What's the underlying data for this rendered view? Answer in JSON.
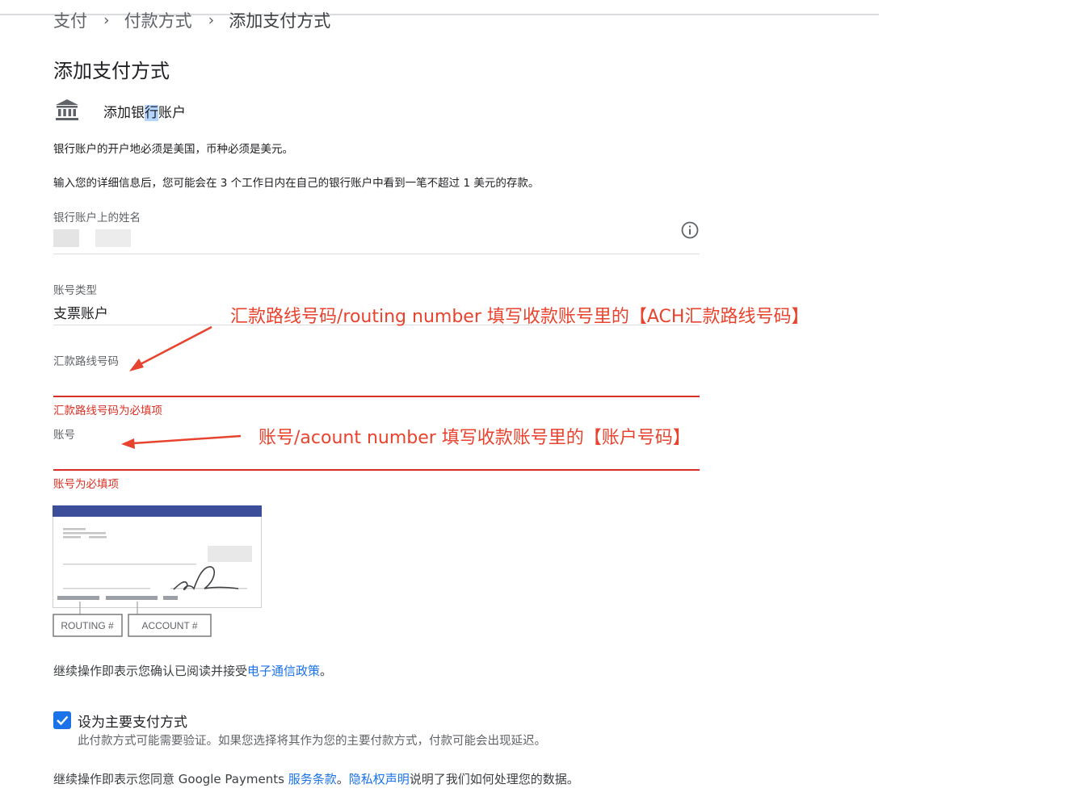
{
  "breadcrumb": {
    "items": [
      "支付",
      "付款方式",
      "添加支付方式"
    ],
    "separator": "›"
  },
  "page": {
    "title": "添加支付方式"
  },
  "bank": {
    "icon": "bank-icon",
    "label_pre": "添加银",
    "label_sel": "行",
    "label_post": "账户"
  },
  "notes": {
    "line1": "银行账户的开户地必须是美国，币种必须是美元。",
    "line2": "输入您的详细信息后，您可能会在 3 个工作日内在自己的银行账户中看到一笔不超过 1 美元的存款。"
  },
  "fields": {
    "name": {
      "label": "银行账户上的姓名",
      "info_icon": "info-icon"
    },
    "account_type": {
      "label": "账号类型",
      "value": "支票账户"
    },
    "routing": {
      "label": "汇款路线号码",
      "error": "汇款路线号码为必填项"
    },
    "account": {
      "label": "账号",
      "error": "账号为必填项"
    }
  },
  "annotations": {
    "routing": "汇款路线号码/routing number 填写收款账号里的【ACH汇款路线号码】",
    "account": "账号/acount number 填写收款账号里的【账户号码】",
    "color": "#e8432e"
  },
  "check_image": {
    "routing_label": "ROUTING #",
    "account_label": "ACCOUNT #"
  },
  "consent": {
    "text": "继续操作即表示您确认已阅读并接受",
    "link": "电子通信政策",
    "end": "。"
  },
  "primary": {
    "checked": true,
    "label": "设为主要支付方式",
    "sub": "此付款方式可能需要验证。如果您选择将其作为您的主要付款方式，付款可能会出现延迟。"
  },
  "terms": {
    "pre": "继续操作即表示您同意 Google Payments ",
    "link1": "服务条款",
    "mid": "。",
    "link2": "隐私权声明",
    "post": "说明了我们如何处理您的数据。"
  },
  "colors": {
    "accent": "#1a73e8",
    "error": "#d93025",
    "check_header": "#3c4d9a"
  }
}
